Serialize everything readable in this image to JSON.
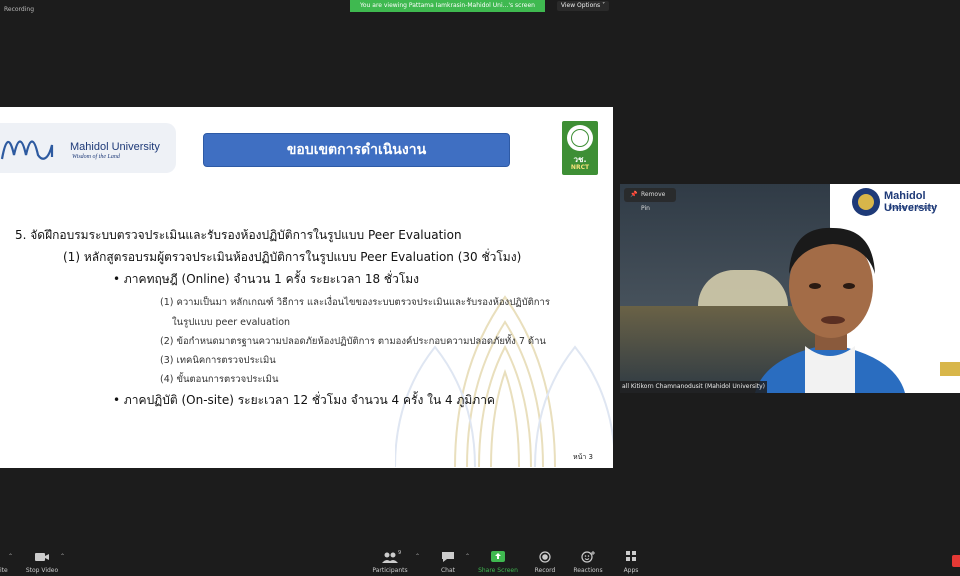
{
  "top": {
    "recording": "Recording",
    "banner": "You are viewing Pattama Iamkrasin-Mahidol Uni...'s screen",
    "view_options": "View Options ˅"
  },
  "slide": {
    "logo": {
      "name": "Mahidol University",
      "tagline": "Wisdom of the Land"
    },
    "title": "ขอบเขตการดำเนินงาน",
    "nrct": {
      "abbr_th": "วช.",
      "abbr_en": "NRCT"
    },
    "lines": {
      "l1": "5. จัดฝึกอบรมระบบตรวจประเมินและรับรองห้องปฏิบัติการในรูปแบบ Peer Evaluation",
      "l2": "(1) หลักสูตรอบรมผู้ตรวจประเมินห้องปฏิบัติการในรูปแบบ Peer Evaluation (30 ชั่วโมง)",
      "l3": "• ภาคทฤษฎี (Online) จำนวน 1 ครั้ง ระยะเวลา 18 ชั่วโมง",
      "s1a": "(1) ความเป็นมา หลักเกณฑ์ วิธีการ และเงื่อนไขของระบบตรวจประเมินและรับรองห้องปฏิบัติการ",
      "s1b": "ในรูปแบบ peer evaluation",
      "s2": "(2) ข้อกำหนดมาตรฐานความปลอดภัยห้องปฏิบัติการ ตามองค์ประกอบความปลอดภัยทั้ง 7 ด้าน",
      "s3": "(3) เทคนิคการตรวจประเมิน",
      "s4": "(4) ขั้นตอนการตรวจประเมิน",
      "l4": "• ภาคปฏิบัติ (On-site) ระยะเวลา 12 ชั่วโมง จำนวน 4 ครั้ง ใน 4 ภูมิภาค"
    },
    "page_no": "หน้า 3"
  },
  "video": {
    "remove_pin": "Remove Pin",
    "participant_name": "all Kitikorn Chamnanodusit (Mahidol University)",
    "overlay_name": "Mahidol University",
    "overlay_tagline": "Wisdom of the Land"
  },
  "toolbar": {
    "items": [
      {
        "label": "Stop Video",
        "icon": "video-camera-icon"
      },
      {
        "label": "Participants",
        "icon": "people-icon",
        "count": "9"
      },
      {
        "label": "Chat",
        "icon": "chat-bubble-icon"
      },
      {
        "label": "Share Screen",
        "icon": "share-screen-icon"
      },
      {
        "label": "Record",
        "icon": "record-icon"
      },
      {
        "label": "Reactions",
        "icon": "smile-plus-icon"
      },
      {
        "label": "Apps",
        "icon": "apps-icon"
      }
    ],
    "partial_left": "ite"
  },
  "colors": {
    "banner": "#3fb950",
    "title_bar": "#3f6fc2",
    "share_green": "#3fb950",
    "end_red": "#e53935"
  }
}
